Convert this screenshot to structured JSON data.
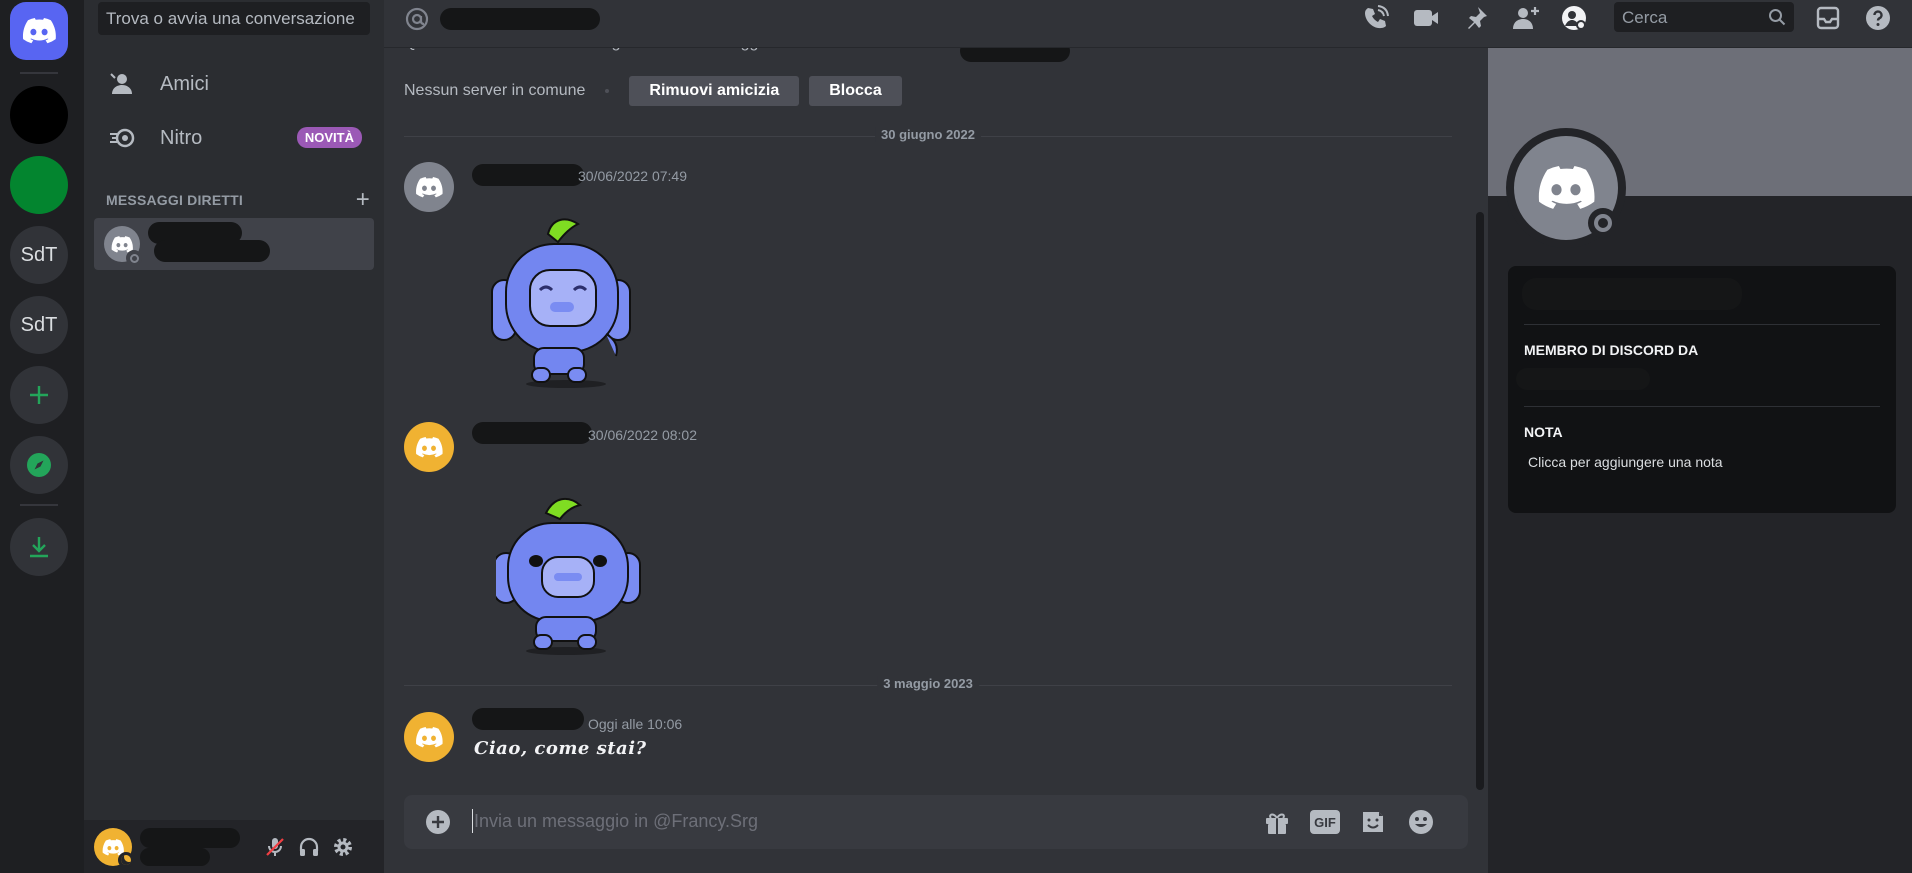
{
  "sidebar": {
    "search_placeholder": "Trova o avvia una conversazione",
    "nav": [
      {
        "label": "Amici",
        "icon": "friends-icon"
      },
      {
        "label": "Nitro",
        "icon": "nitro-icon",
        "badge": "NOVITÀ"
      }
    ],
    "dm_header": "MESSAGGI DIRETTI",
    "dm_add": "+"
  },
  "servers": [
    {
      "label": "SdT"
    },
    {
      "label": "SdT"
    }
  ],
  "chat": {
    "intro_text": "Questo è l'inizio della cronologia dei tuoi messaggi diretti tra te e",
    "common_servers": "Nessun server in comune",
    "remove_friend": "Rimuovi amicizia",
    "block": "Blocca",
    "date_dividers": [
      "30 giugno 2022",
      "3 maggio 2023"
    ],
    "messages": [
      {
        "time": "30/06/2022 07:49"
      },
      {
        "time": "30/06/2022 08:02"
      },
      {
        "time": "Oggi alle 10:06",
        "text": "Ciao, come stai?"
      }
    ],
    "composer_placeholder": "Invia un messaggio in @Francy.Srg",
    "gif_label": "GIF"
  },
  "toolbar": {
    "search_placeholder": "Cerca"
  },
  "profile": {
    "member_since_label": "MEMBRO DI DISCORD DA",
    "note_label": "NOTA",
    "note_placeholder": "Clicca per aggiungere una nota"
  },
  "colors": {
    "brand": "#5865f2",
    "green": "#23a55a",
    "nitro_badge": "#9b59b6",
    "avatar_orange": "#f0b232"
  }
}
